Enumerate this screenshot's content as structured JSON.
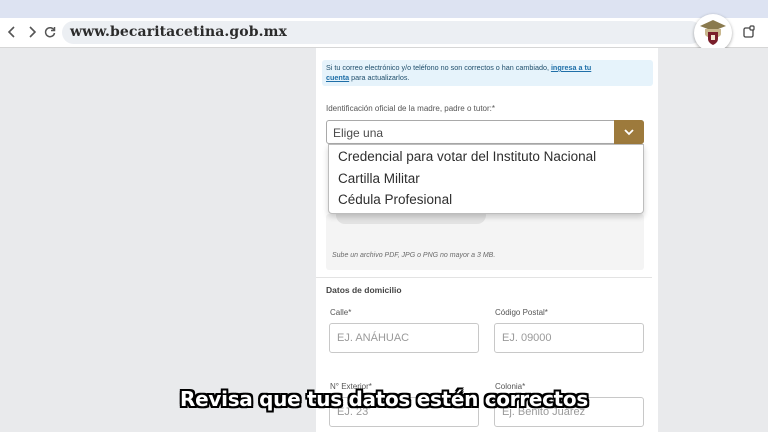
{
  "browser": {
    "url": "www.becaritacetina.gob.mx"
  },
  "info_box": {
    "text_before_link": "Si tu correo electrónico y/o teléfono no son correctos o han cambiado, ",
    "link_part1": "ingresa a tu",
    "link_part2": "cuenta",
    "text_after_link": " para actualizarlos."
  },
  "id_field": {
    "label": "Identificación oficial de la madre, padre o tutor:*",
    "placeholder": "Elige una",
    "options": [
      "Credencial para votar del Instituto Nacional",
      "Cartilla Militar",
      "Cédula Profesional"
    ]
  },
  "upload": {
    "note": "Sube un archivo PDF, JPG o PNG no mayor a 3 MB."
  },
  "address": {
    "section_title": "Datos de domicilio",
    "calle": {
      "label": "Calle*",
      "placeholder": "EJ. ANÁHUAC"
    },
    "codigo_postal": {
      "label": "Código Postal*",
      "placeholder": "EJ. 09000"
    },
    "numero_exterior": {
      "label": "N° Exterior*",
      "placeholder": "EJ. 23"
    },
    "colonia": {
      "label": "Colonia*",
      "placeholder": "Ej. Benito Juárez"
    }
  },
  "caption": "Revisa que tus datos estén correctos",
  "colors": {
    "accent": "#9d7a3c",
    "info_bg": "#e6f3fb",
    "link": "#1f6fa8"
  },
  "icons": [
    "back-icon",
    "forward-icon",
    "reload-icon",
    "extensions-icon",
    "logo-emblem",
    "chevron-down-icon"
  ]
}
